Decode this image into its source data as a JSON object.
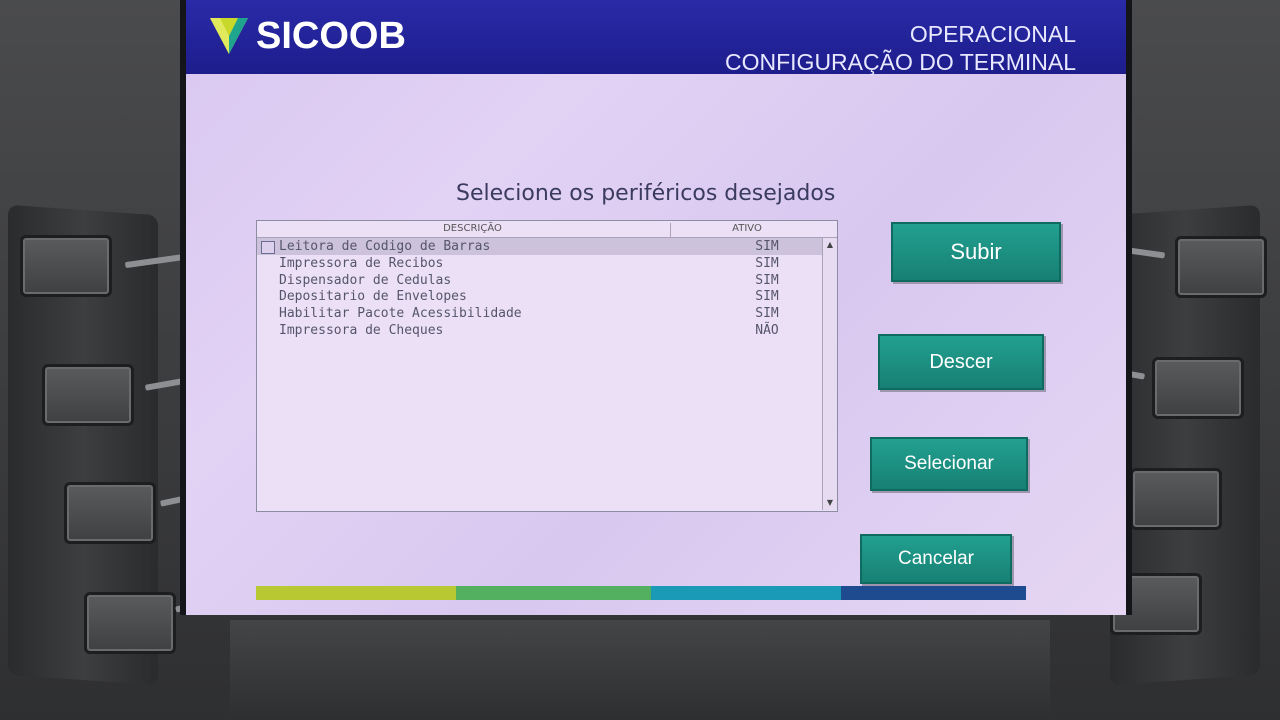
{
  "header": {
    "brand": "SICOOB",
    "mode": "OPERACIONAL",
    "screen_title": "CONFIGURAÇÃO DO TERMINAL"
  },
  "prompt": "Selecione os periféricos desejados",
  "list": {
    "columns": {
      "description": "DESCRIÇÃO",
      "active": "ATIVO"
    },
    "rows": [
      {
        "description": "Leitora de Codigo de Barras",
        "active": "SIM"
      },
      {
        "description": "Impressora de Recibos",
        "active": "SIM"
      },
      {
        "description": "Dispensador de Cedulas",
        "active": "SIM"
      },
      {
        "description": "Depositario de Envelopes",
        "active": "SIM"
      },
      {
        "description": "Habilitar Pacote Acessibilidade",
        "active": "SIM"
      },
      {
        "description": "Impressora de Cheques",
        "active": "NÃO"
      }
    ]
  },
  "buttons": {
    "up": "Subir",
    "down": "Descer",
    "select": "Selecionar",
    "cancel": "Cancelar"
  },
  "colors": {
    "header_blue": "#1d1d8c",
    "button_teal": "#1c9485",
    "stripe": [
      "#b8c832",
      "#52b060",
      "#1b9ab8",
      "#1e4a90"
    ]
  }
}
